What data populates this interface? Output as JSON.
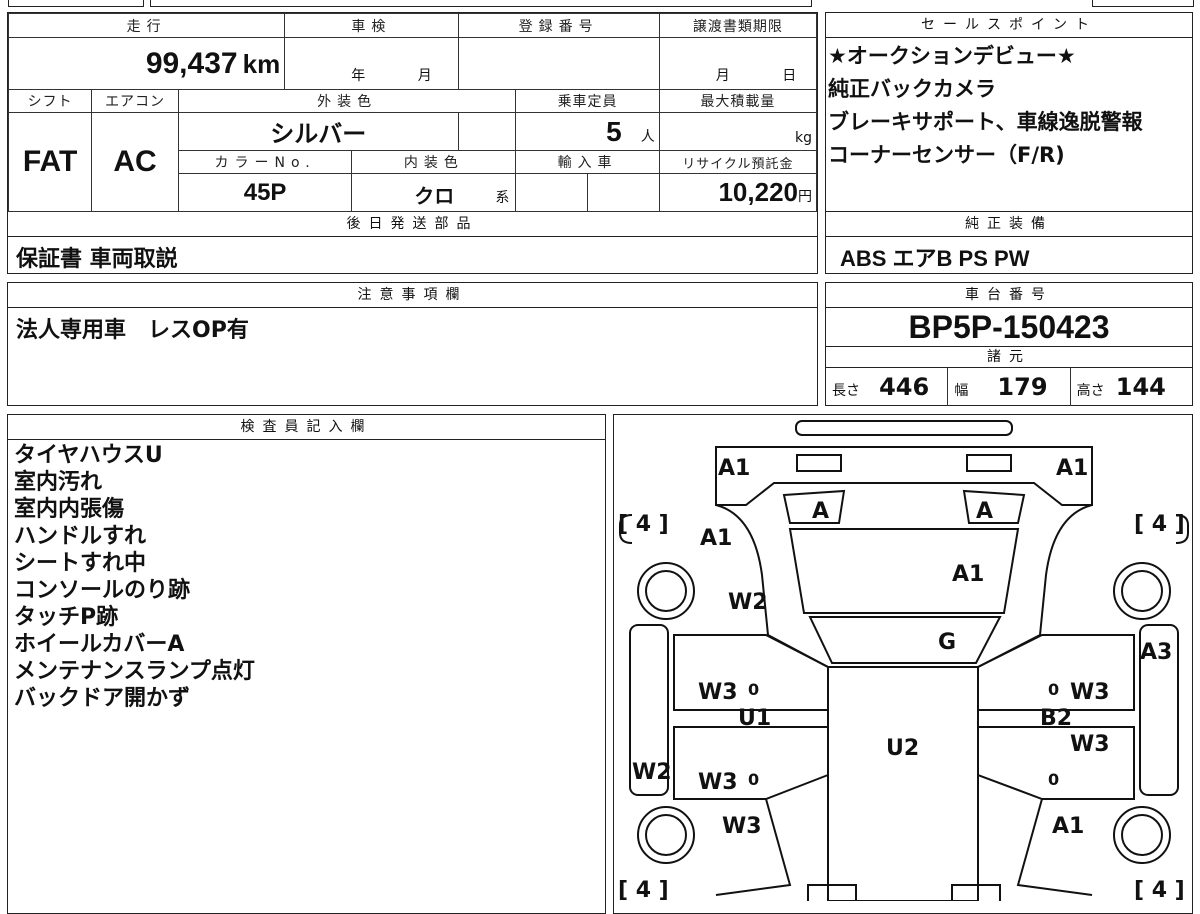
{
  "main": {
    "mileage": {
      "label": "走行",
      "value": "99,437",
      "unit": "km"
    },
    "inspection": {
      "label": "車検",
      "year_unit": "年",
      "month_unit": "月"
    },
    "registration": {
      "label": "登録番号"
    },
    "transfer_deadline": {
      "label": "譲渡書類期限",
      "month_unit": "月",
      "day_unit": "日"
    },
    "shift": {
      "label": "シフト",
      "value": "FAT"
    },
    "aircon": {
      "label": "エアコン",
      "value": "AC"
    },
    "exterior_color": {
      "label": "外装色",
      "value": "シルバー"
    },
    "capacity": {
      "label": "乗車定員",
      "value": "5",
      "unit": "人"
    },
    "max_load": {
      "label": "最大積載量",
      "unit": "kg"
    },
    "color_no": {
      "label": "カラーNo.",
      "value": "45P"
    },
    "interior_color": {
      "label": "内装色",
      "value": "クロ",
      "suffix": "系"
    },
    "import": {
      "label": "輸入車"
    },
    "recycle": {
      "label": "リサイクル預託金",
      "value": "10,220",
      "unit": "円"
    }
  },
  "later_parts": {
    "title": "後日発送部品",
    "text": "保証書 車両取説"
  },
  "notes": {
    "title": "注意事項欄",
    "text": "法人専用車　レスOP有"
  },
  "sales_points": {
    "title": "セールスポイント",
    "lines": [
      "★オークションデビュー★",
      "純正バックカメラ",
      "ブレーキサポート、車線逸脱警報",
      "コーナーセンサー（F/R)"
    ]
  },
  "standard_equipment": {
    "title": "純正装備",
    "text": "ABS エアB PS PW"
  },
  "chassis": {
    "title": "車台番号",
    "value": "BP5P-150423"
  },
  "specs": {
    "title": "諸元",
    "length": {
      "label": "長さ",
      "value": "446"
    },
    "width": {
      "label": "幅",
      "value": "179"
    },
    "height": {
      "label": "高さ",
      "value": "144"
    }
  },
  "inspector": {
    "title": "検査員記入欄",
    "lines": [
      "タイヤハウスU",
      "室内汚れ",
      "室内内張傷",
      "ハンドルすれ",
      "シートすれ中",
      "コンソールのり跡",
      "タッチP跡",
      "ホイールカバーA",
      "メンテナンスランプ点灯",
      "バックドア開かず"
    ]
  },
  "diagram": {
    "marks": {
      "a1_front_left": "A1",
      "a1_front_right": "A1",
      "a_left": "A",
      "a_right": "A",
      "a1_fender_left": "A1",
      "a1_hood": "A1",
      "w2_fender_left": "W2",
      "g_windshield": "G",
      "a3_right": "A3",
      "w3_front_left_door": "W3",
      "u1_left": "U1",
      "w3_front_right_door": "W3",
      "b2_right": "B2",
      "w3_rear_right_door": "W3",
      "u2_roof": "U2",
      "w2_side_left": "W2",
      "w3_rear_left_door": "W3",
      "w3_rear_left_quarter": "W3",
      "a1_rear_right": "A1"
    },
    "tire_front_left": "[ 4 ]",
    "tire_front_right": "[ 4 ]",
    "tire_rear_left": "[ 4 ]",
    "tire_rear_right": "[ 4 ]",
    "zero_marks": [
      "0",
      "0",
      "0",
      "0"
    ]
  }
}
